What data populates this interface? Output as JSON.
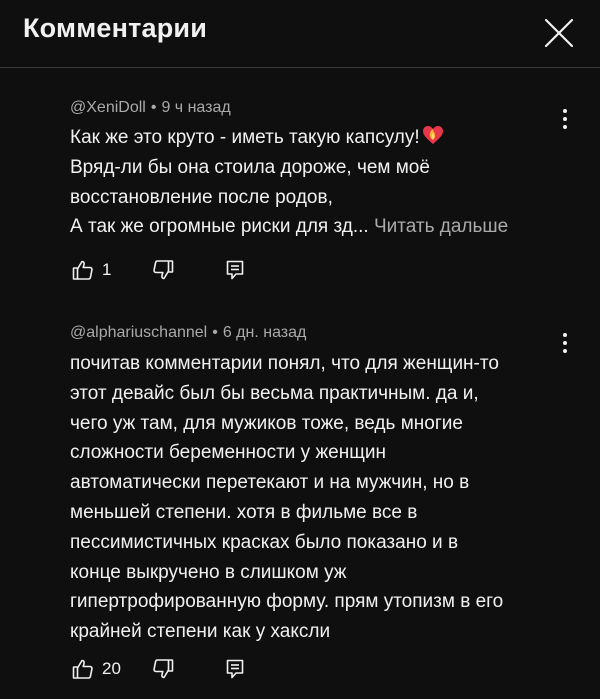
{
  "header": {
    "title": "Комментарии"
  },
  "comments": [
    {
      "author": "@XeniDoll",
      "separator": "•",
      "time": "9 ч назад",
      "lines": [
        "Как же это круто - иметь такую капсулу!",
        "Вряд-ли бы она стоила дороже, чем моё",
        "восстановление после родов,",
        "А так же огромные риски для зд..."
      ],
      "read_more": "Читать дальше",
      "emoji_icon": "burning-heart-icon",
      "likes": "1"
    },
    {
      "author": "@alphariuschannel",
      "separator": "•",
      "time": "6 дн. назад",
      "lines": [
        "почитав комментарии понял, что для женщин-то",
        "этот девайс был бы весьма практичным. да и,",
        "чего уж там, для мужиков тоже, ведь многие",
        "сложности беременности у женщин",
        "автоматически перетекают и на мужчин, но в",
        "меньшей степени. хотя в фильме все в",
        "пессимистичных красках было показано и в",
        "конце выкручено в слишком уж",
        "гипертрофированную форму. прям утопизм в его",
        "крайней степени как у хаксли"
      ],
      "likes": "20"
    }
  ],
  "colors": {
    "background": "#0f0f0f",
    "text": "#f1f1f1",
    "secondary": "#aaaaaa",
    "divider": "#3a3a3a"
  }
}
